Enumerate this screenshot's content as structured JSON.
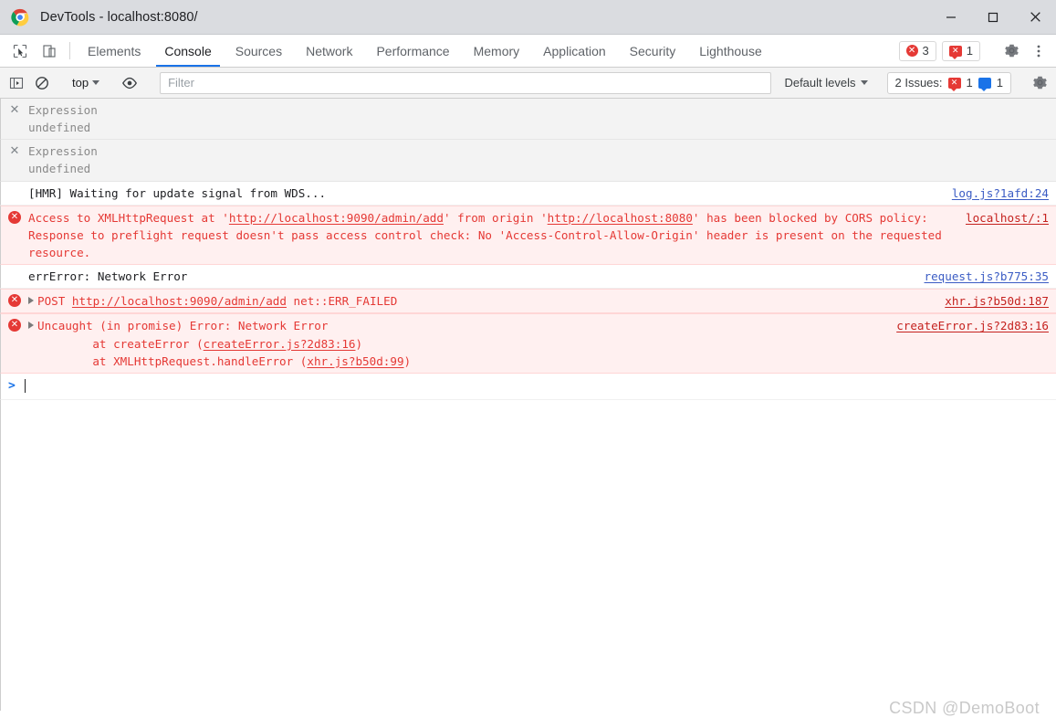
{
  "titlebar": {
    "title": "DevTools - localhost:8080/",
    "logo_icon": "chrome-logo-icon",
    "minimize_label": "—",
    "maximize_label": "□",
    "close_label": "✕"
  },
  "tabbar": {
    "inspect_icon": "inspect-cursor-icon",
    "device_icon": "device-toolbar-icon",
    "tabs": [
      {
        "label": "Elements",
        "active": false
      },
      {
        "label": "Console",
        "active": true
      },
      {
        "label": "Sources",
        "active": false
      },
      {
        "label": "Network",
        "active": false
      },
      {
        "label": "Performance",
        "active": false
      },
      {
        "label": "Memory",
        "active": false
      },
      {
        "label": "Application",
        "active": false
      },
      {
        "label": "Security",
        "active": false
      },
      {
        "label": "Lighthouse",
        "active": false
      }
    ],
    "error_count": "3",
    "warning_count": "1",
    "settings_icon": "gear-icon",
    "more_icon": "more-vertical-icon"
  },
  "toolbar": {
    "sidebar_icon": "console-sidebar-icon",
    "clear_icon": "clear-console-icon",
    "context": "top",
    "eye_icon": "live-expression-eye-icon",
    "filter_placeholder": "Filter",
    "filter_value": "",
    "levels_label": "Default levels",
    "issues_label": "2 Issues:",
    "issues_error_count": "1",
    "issues_info_count": "1",
    "settings_icon": "console-settings-gear-icon"
  },
  "console": {
    "messages": [
      {
        "kind": "eager",
        "icon": "close-x-icon",
        "title": "Expression",
        "value": "undefined",
        "source": ""
      },
      {
        "kind": "eager",
        "icon": "close-x-icon",
        "title": "Expression",
        "value": "undefined",
        "source": ""
      },
      {
        "kind": "plain",
        "text": "[HMR] Waiting for update signal from WDS...",
        "source": "log.js?1afd:24"
      },
      {
        "kind": "error",
        "icon": "error-circle-icon",
        "text_part1": "Access to XMLHttpRequest at '",
        "link1": "http://localhost:9090/admin/add",
        "text_part2": "' from origin '",
        "link2": "http://localhost:8080",
        "text_part3": "' has been blocked by CORS policy: Response to preflight request doesn't pass access control check: No 'Access-Control-Allow-Origin' header is present on the requested resource.",
        "source": "localhost/:1"
      },
      {
        "kind": "plain",
        "text": "errError: Network Error",
        "source": "request.js?b775:35"
      },
      {
        "kind": "error",
        "icon": "error-circle-icon",
        "expandable": true,
        "text_part1": "POST ",
        "link1": "http://localhost:9090/admin/add",
        "text_part2": " net::ERR_FAILED",
        "source": "xhr.js?b50d:187"
      },
      {
        "kind": "error",
        "icon": "error-circle-icon",
        "expandable": true,
        "text_part1": "Uncaught (in promise) Error: Network Error",
        "stack": [
          {
            "prefix": "    at createError (",
            "link": "createError.js?2d83:16",
            "suffix": ")"
          },
          {
            "prefix": "    at XMLHttpRequest.handleError (",
            "link": "xhr.js?b50d:99",
            "suffix": ")"
          }
        ],
        "source": "createError.js?2d83:16"
      }
    ],
    "prompt_chevron": ">",
    "prompt_value": ""
  },
  "watermark": "CSDN @DemoBoot",
  "colors": {
    "accent": "#1a73e8",
    "error": "#e53935",
    "error_bg": "#fff0f0",
    "link": "#3b5cc4",
    "titlebar_bg": "#dadce0"
  }
}
